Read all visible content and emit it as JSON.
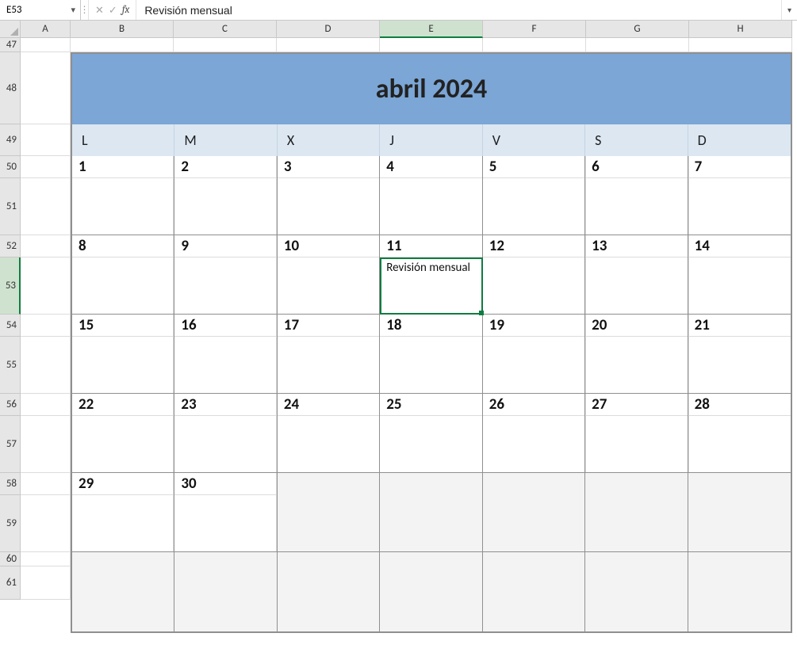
{
  "formula_bar": {
    "cell_ref": "E53",
    "value": "Revisión mensual"
  },
  "columns": [
    "A",
    "B",
    "C",
    "D",
    "E",
    "F",
    "G",
    "H"
  ],
  "rows": [
    "47",
    "48",
    "49",
    "50",
    "51",
    "52",
    "53",
    "54",
    "55",
    "56",
    "57",
    "58",
    "59",
    "60",
    "61"
  ],
  "selected_col": "E",
  "selected_row": "53",
  "calendar": {
    "title": "abril 2024",
    "weekdays": [
      "L",
      "M",
      "X",
      "J",
      "V",
      "S",
      "D"
    ],
    "weeks": [
      {
        "days": [
          "1",
          "2",
          "3",
          "4",
          "5",
          "6",
          "7"
        ],
        "notes": [
          "",
          "",
          "",
          "",
          "",
          "",
          ""
        ],
        "dim": [
          false,
          false,
          false,
          false,
          false,
          false,
          false
        ]
      },
      {
        "days": [
          "8",
          "9",
          "10",
          "11",
          "12",
          "13",
          "14"
        ],
        "notes": [
          "",
          "",
          "",
          "Revisión mensual",
          "",
          "",
          ""
        ],
        "dim": [
          false,
          false,
          false,
          false,
          false,
          false,
          false
        ]
      },
      {
        "days": [
          "15",
          "16",
          "17",
          "18",
          "19",
          "20",
          "21"
        ],
        "notes": [
          "",
          "",
          "",
          "",
          "",
          "",
          ""
        ],
        "dim": [
          false,
          false,
          false,
          false,
          false,
          false,
          false
        ]
      },
      {
        "days": [
          "22",
          "23",
          "24",
          "25",
          "26",
          "27",
          "28"
        ],
        "notes": [
          "",
          "",
          "",
          "",
          "",
          "",
          ""
        ],
        "dim": [
          false,
          false,
          false,
          false,
          false,
          false,
          false
        ]
      },
      {
        "days": [
          "29",
          "30",
          "",
          "",
          "",
          "",
          ""
        ],
        "notes": [
          "",
          "",
          "",
          "",
          "",
          "",
          ""
        ],
        "dim": [
          false,
          false,
          true,
          true,
          true,
          true,
          true
        ]
      },
      {
        "days": [
          "",
          "",
          "",
          "",
          "",
          "",
          ""
        ],
        "notes": [
          "",
          "",
          "",
          "",
          "",
          "",
          ""
        ],
        "dim": [
          true,
          true,
          true,
          true,
          true,
          true,
          true
        ]
      }
    ]
  }
}
